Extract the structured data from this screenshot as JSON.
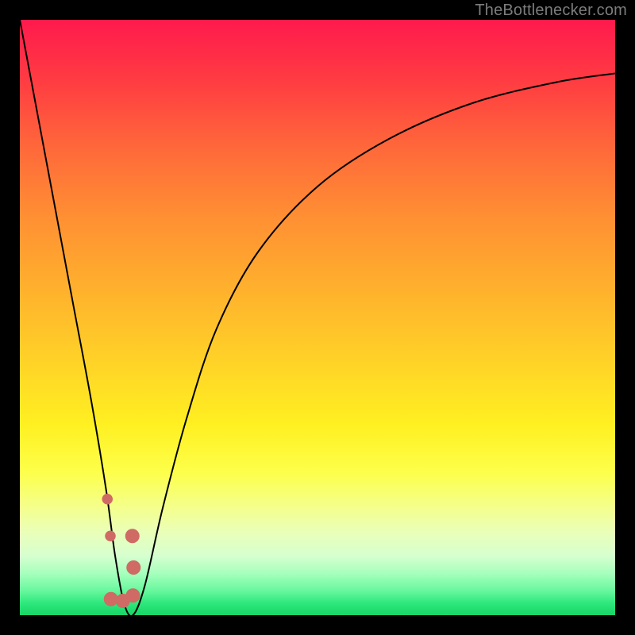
{
  "watermark": {
    "text": "TheBottlenecker.com"
  },
  "colors": {
    "frame": "#000000",
    "curve": "#000000",
    "marker": "#cf6a64",
    "watermark": "#7c7c7c",
    "gradient_stops": [
      "#ff1a4d",
      "#ff3b42",
      "#ff6a3a",
      "#ff8f33",
      "#ffb02d",
      "#ffd427",
      "#fff021",
      "#fdff4a",
      "#f4ff8d",
      "#eaffb8",
      "#d6ffcf",
      "#a6ffbd",
      "#65f79c",
      "#2de87c",
      "#18d567"
    ]
  },
  "chart_data": {
    "type": "line",
    "title": "",
    "xlabel": "",
    "ylabel": "",
    "xlim": [
      0,
      100
    ],
    "ylim": [
      0,
      100
    ],
    "grid": false,
    "legend": false,
    "annotations": [
      "TheBottlenecker.com"
    ],
    "series": [
      {
        "name": "bottleneck-curve",
        "x": [
          0,
          3,
          6,
          9,
          12,
          14.5,
          16,
          17.5,
          19,
          21,
          24,
          28,
          33,
          40,
          50,
          62,
          76,
          90,
          100
        ],
        "y": [
          100,
          84,
          68,
          52,
          36,
          21,
          10,
          2,
          0,
          5,
          18,
          33,
          48,
          61,
          72,
          80,
          86,
          89.5,
          91
        ]
      }
    ],
    "markers": [
      {
        "name": "dot-upper",
        "x": 14.7,
        "y": 19.5,
        "r": 0.9
      },
      {
        "name": "dot-lower",
        "x": 15.2,
        "y": 13.3,
        "r": 0.9
      },
      {
        "name": "j-top",
        "x": 18.9,
        "y": 13.3,
        "r": 1.2
      },
      {
        "name": "j-mid",
        "x": 19.1,
        "y": 8.0,
        "r": 1.2
      },
      {
        "name": "j-corner",
        "x": 19.0,
        "y": 3.3,
        "r": 1.2
      },
      {
        "name": "j-bottom-1",
        "x": 17.3,
        "y": 2.4,
        "r": 1.2
      },
      {
        "name": "j-bottom-2",
        "x": 15.3,
        "y": 2.7,
        "r": 1.2
      }
    ]
  }
}
